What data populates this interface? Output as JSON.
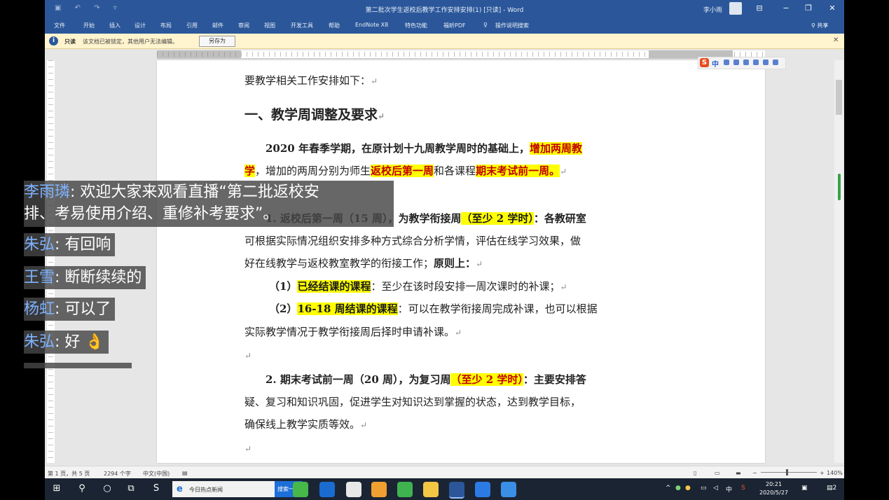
{
  "window": {
    "title": "第二批次学生返校后教学工作安排安排(1) [只读] - Word",
    "user": "李小雨",
    "controls": [
      "⊟",
      "−",
      "❐",
      "✕"
    ]
  },
  "ribbon": {
    "tabs": [
      "文件",
      "开始",
      "插入",
      "设计",
      "布局",
      "引用",
      "邮件",
      "审阅",
      "视图",
      "开发工具",
      "帮助",
      "EndNote X8",
      "特色功能",
      "福昕PDF",
      "操作说明搜索"
    ],
    "share": "共享"
  },
  "message_bar": {
    "label": "只读",
    "text": "该文档已被锁定，其他用户无法编辑。",
    "button": "另存为"
  },
  "document": {
    "intro": "要教学相关工作安排如下：",
    "heading": "一、教学周调整及要求",
    "p1_a": "2020 年春季学期，在原计划十九周教学周时的基础上，",
    "p1_hl1": "增加两周教",
    "p1_hl1b": "学",
    "p1_b": "，增加的两周分别为师生",
    "p1_hl2": "返校后第一周",
    "p1_c": "和各课程",
    "p1_hl3": "期末考试前一周。",
    "p2_a": "1. 返校后第一周（15 周），为教学衔接周",
    "p2_hl": "（至少 2 学时）",
    "p2_b": "：各教研室",
    "p2_line2": "可根据实际情况组织安排多种方式综合分析学情，评估在线学习效果，做",
    "p2_line3a": "好在线教学与返校教室教学的衔接工作；",
    "p2_line3b": "原则上：",
    "item1_num": "（1）",
    "item1_hl": "已经结课的课程",
    "item1_text": "：至少在该时段安排一周次课时的补课；",
    "item2_num": "（2）",
    "item2_hl": "16-18 周结课的课程",
    "item2_text": "：可以在教学衔接周完成补课，也可以根据",
    "item2_line2": "实际教学情况于教学衔接周后择时申请补课。",
    "p3_a": "2. 期末考试前一周（20 周），为复习周",
    "p3_hl": "（至少 2 学时）",
    "p3_b": "：主要安排答",
    "p3_line2": "疑、复习和知识巩固，促进学生对知识达到掌握的状态，达到教学目标，",
    "p3_line3": "确保线上教学实质等效。",
    "para_mark": "↵"
  },
  "ime": {
    "logo": "S",
    "mode": "中"
  },
  "status_bar": {
    "page": "第 1 页，共 5 页",
    "words": "2294 个字",
    "lang": "中文(中国)",
    "zoom": "140%"
  },
  "taskbar": {
    "search_text": "今日热点新闻",
    "search_button": "搜索一下",
    "time": "20:21",
    "date": "2020/5/27",
    "ime_tray": "中",
    "notify_count": "2"
  },
  "chat": [
    {
      "user": "李雨璘",
      "text_line1": "欢迎大家来观看直播“第二批返校安",
      "text_line2": "排、考易使用介绍、重修补考要求”。"
    },
    {
      "user": "朱弘",
      "text": "有回响"
    },
    {
      "user": "王雪",
      "text": "断断续续的"
    },
    {
      "user": "杨虹",
      "text": "可以了"
    },
    {
      "user": "朱弘",
      "text": "好 👌"
    }
  ]
}
